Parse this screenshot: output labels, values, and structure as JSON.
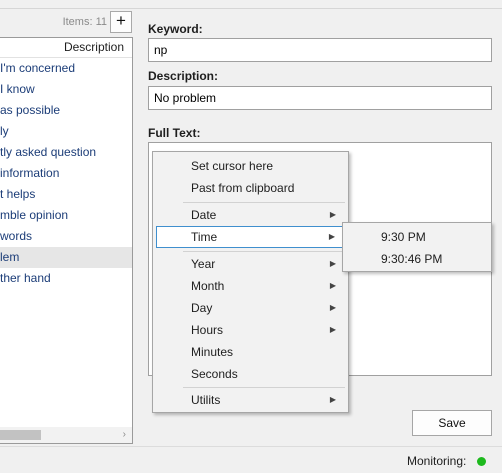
{
  "left_panel": {
    "items_count": "Items: 11",
    "add_label": "+",
    "column_header": "Description",
    "rows": [
      "I'm concerned",
      "I know",
      "as possible",
      "ly",
      "tly asked question",
      "information",
      "t helps",
      "mble opinion",
      "words",
      "lem",
      "ther hand"
    ],
    "selected_index": 9,
    "scroll_right_arrow": "›"
  },
  "form": {
    "keyword_label": "Keyword:",
    "keyword_value": "np",
    "description_label": "Description:",
    "description_value": "No problem",
    "full_text_label": "Full Text:",
    "save_label": "Save"
  },
  "status": {
    "label": "Monitoring:",
    "indicator_color": "#1db91d"
  },
  "context_menu": {
    "items": [
      {
        "label": "Set cursor here",
        "submenu": false
      },
      {
        "label": "Past from clipboard",
        "submenu": false
      },
      {
        "label": "Date",
        "submenu": true
      },
      {
        "label": "Time",
        "submenu": true,
        "highlighted": true
      },
      {
        "label": "Year",
        "submenu": true
      },
      {
        "label": "Month",
        "submenu": true
      },
      {
        "label": "Day",
        "submenu": true
      },
      {
        "label": "Hours",
        "submenu": true
      },
      {
        "label": "Minutes",
        "submenu": false
      },
      {
        "label": "Seconds",
        "submenu": false
      },
      {
        "label": "Utilits",
        "submenu": true
      }
    ],
    "arrow_glyph": "▶"
  },
  "time_submenu": {
    "items": [
      "9:30 PM",
      "9:30:46 PM"
    ]
  }
}
